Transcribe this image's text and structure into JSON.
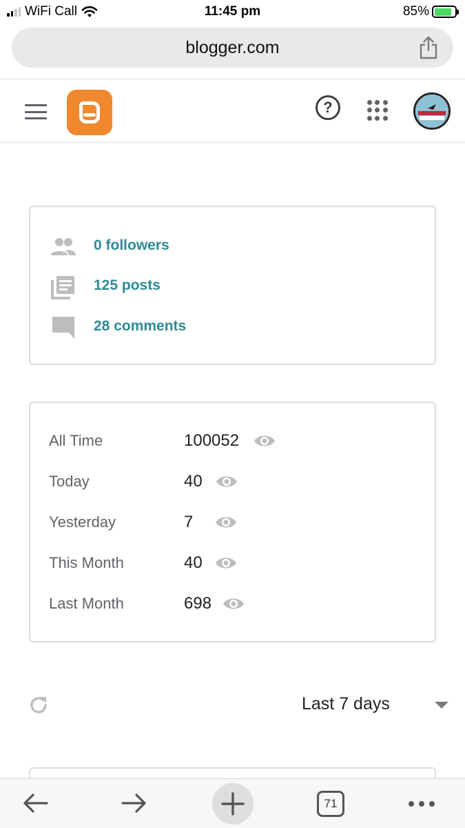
{
  "status_bar": {
    "carrier": "WiFi Call",
    "time": "11:45 pm",
    "battery": "85%",
    "battery_level": 0.85
  },
  "browser": {
    "url": "blogger.com",
    "tab_count": "71"
  },
  "header": {
    "icons": [
      "menu-icon",
      "blogger-logo",
      "help-icon",
      "apps-icon",
      "avatar"
    ]
  },
  "stats": {
    "followers": "0 followers",
    "posts": "125 posts",
    "comments": "28 comments"
  },
  "views": {
    "rows": [
      {
        "label": "All Time",
        "value": "100052"
      },
      {
        "label": "Today",
        "value": "40"
      },
      {
        "label": "Yesterday",
        "value": "7"
      },
      {
        "label": "This Month",
        "value": "40"
      },
      {
        "label": "Last Month",
        "value": "698"
      }
    ]
  },
  "range": {
    "label": "Last 7 days"
  },
  "colors": {
    "accent_teal": "#2e8a94",
    "blogger_orange": "#f0882e",
    "icon_gray": "#bdbdbd"
  }
}
